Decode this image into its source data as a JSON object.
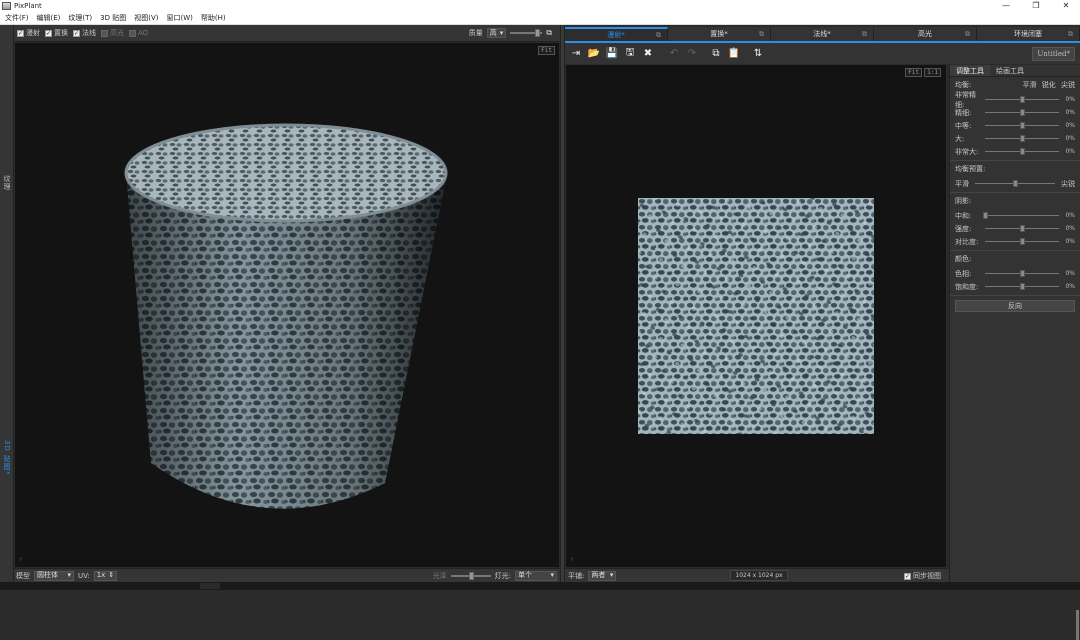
{
  "app": {
    "title": "PixPlant"
  },
  "window_controls": {
    "minimize": "—",
    "restore": "❐",
    "close": "✕"
  },
  "menu": [
    "文件(F)",
    "编辑(E)",
    "纹理(T)",
    "3D 贴图",
    "视图(V)",
    "窗口(W)",
    "帮助(H)"
  ],
  "left_strip": {
    "tab_texture": "纹理",
    "tab_3d": "3D 贴图*"
  },
  "view3d_toolbar": {
    "checks": [
      {
        "label": "漫射",
        "checked": true
      },
      {
        "label": "置换",
        "checked": true
      },
      {
        "label": "法线",
        "checked": true
      },
      {
        "label": "高光",
        "checked": false
      },
      {
        "label": "AO",
        "checked": false
      }
    ],
    "quality_label": "质量",
    "quality_value": "高",
    "quality_slider": 0.85
  },
  "view3d": {
    "fit_label": "Fit"
  },
  "view3d_bottom": {
    "model_label": "模型",
    "model_value": "圆柱体",
    "uv_label": "UV:",
    "uv_value": "1x",
    "gloss_label": "光泽",
    "gloss_slider": 0.5,
    "light_label": "灯光:",
    "light_value": "单个"
  },
  "map_tabs": [
    {
      "label": "漫射*",
      "active": true
    },
    {
      "label": "置换*",
      "active": false
    },
    {
      "label": "法线*",
      "active": false
    },
    {
      "label": "高光",
      "active": false
    },
    {
      "label": "环境闭塞",
      "active": false
    }
  ],
  "map_toolbar": {
    "icons": [
      "import-icon",
      "open-folder-icon",
      "save-icon",
      "save-as-icon",
      "clear-icon",
      "undo-icon",
      "redo-icon",
      "copy-icon",
      "paste-icon",
      "swap-icon"
    ],
    "icon_glyphs": [
      "⇥",
      "📂",
      "💾",
      "🖫",
      "✖",
      "↶",
      "↷",
      "⧉",
      "📋",
      "⇅"
    ],
    "untitled": "Untitled*"
  },
  "view2d": {
    "fit_label": "Fit",
    "one_to_one": "1:1"
  },
  "view2d_bottom": {
    "tile_label": "平铺:",
    "tile_value": "两者",
    "size": "1024 x 1024 px",
    "sync_label": "同步视图",
    "sync_checked": true
  },
  "panel": {
    "tabs": [
      {
        "label": "调整工具",
        "active": true
      },
      {
        "label": "绘画工具",
        "active": false
      }
    ],
    "equalize": {
      "title": "均衡:",
      "options": [
        "平滑",
        "锐化",
        "尖锐"
      ],
      "rows": [
        {
          "label": "非常精细:",
          "pos": 0.5,
          "value": "0%"
        },
        {
          "label": "精细:",
          "pos": 0.5,
          "value": "0%"
        },
        {
          "label": "中等:",
          "pos": 0.5,
          "value": "0%"
        },
        {
          "label": "大:",
          "pos": 0.5,
          "value": "0%"
        },
        {
          "label": "非常大:",
          "pos": 0.5,
          "value": "0%"
        }
      ]
    },
    "preset": {
      "title": "均衡预置:",
      "left": "平滑",
      "right": "尖锐",
      "pos": 0.5
    },
    "shadows": {
      "title": "阴影:",
      "rows": [
        {
          "label": "中和:",
          "pos": 0.0,
          "value": "0%"
        },
        {
          "label": "强度:",
          "pos": 0.5,
          "value": "0%"
        },
        {
          "label": "对比度:",
          "pos": 0.5,
          "value": "0%"
        }
      ]
    },
    "color": {
      "title": "颜色:",
      "rows": [
        {
          "label": "色相:",
          "pos": 0.5,
          "value": "0%"
        },
        {
          "label": "饱和度:",
          "pos": 0.5,
          "value": "0%"
        }
      ]
    },
    "reverse_button": "反向"
  }
}
